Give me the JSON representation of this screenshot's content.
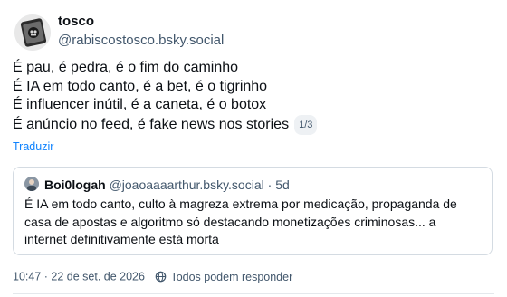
{
  "post": {
    "author": {
      "display_name": "tosco",
      "handle": "@rabiscostosco.bsky.social"
    },
    "text_lines": [
      "É pau, é pedra, é o fim do caminho",
      "É IA em todo canto, é a bet, é o tigrinho",
      "É influencer inútil, é a caneta, é o botox",
      "É anúncio no feed, é fake news nos stories"
    ],
    "thread_position": "1/3",
    "translate_label": "Traduzir",
    "quote": {
      "author_name": "Boi0logah",
      "author_handle": "@joaoaaaarthur.bsky.social",
      "separator": "·",
      "time": "5d",
      "text_lines": [
        "É IA em todo canto, culto à magreza extrema por medicação, propaganda de",
        "casa de apostas e algoritmo só destacando monetizações criminosas... a",
        "internet definitivamente está morta"
      ]
    },
    "timestamp": "10:47 · 22 de set. de 2026",
    "reply_setting": "Todos podem responder"
  },
  "colors": {
    "link": "#1083fe",
    "muted": "#42576c",
    "border": "#d4dbe2"
  }
}
